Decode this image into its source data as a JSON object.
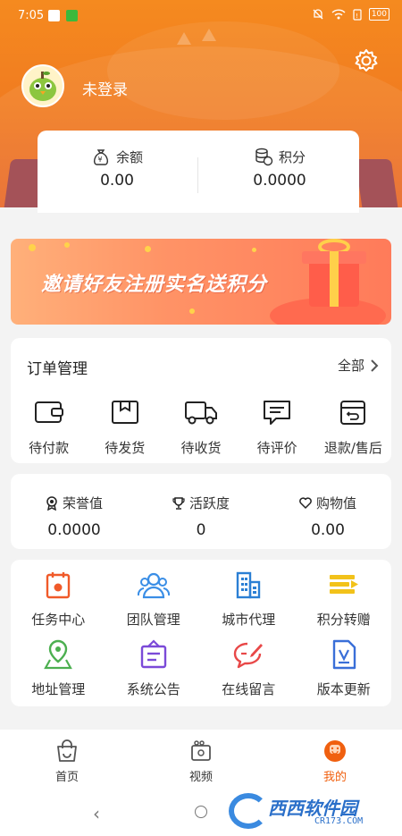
{
  "status_bar": {
    "time": "7:05",
    "battery": "100"
  },
  "user": {
    "name": "未登录"
  },
  "balance": {
    "balance_label": "余额",
    "balance_value": "0.00",
    "points_label": "积分",
    "points_value": "0.0000"
  },
  "banner": {
    "text": "邀请好友注册实名送积分"
  },
  "orders": {
    "title": "订单管理",
    "all_label": "全部",
    "items": [
      {
        "label": "待付款",
        "icon": "wallet-icon"
      },
      {
        "label": "待发货",
        "icon": "box-icon"
      },
      {
        "label": "待收货",
        "icon": "truck-icon"
      },
      {
        "label": "待评价",
        "icon": "comment-icon"
      },
      {
        "label": "退款/售后",
        "icon": "refund-icon"
      }
    ]
  },
  "stats": [
    {
      "label": "荣誉值",
      "value": "0.0000",
      "icon": "medal-icon"
    },
    {
      "label": "活跃度",
      "value": "0",
      "icon": "trophy-icon"
    },
    {
      "label": "购物值",
      "value": "0.00",
      "icon": "heart-icon"
    }
  ],
  "services": [
    {
      "label": "任务中心",
      "icon": "calendar-icon",
      "color": "#f05a2a"
    },
    {
      "label": "团队管理",
      "icon": "team-icon",
      "color": "#3a8ee6"
    },
    {
      "label": "城市代理",
      "icon": "building-icon",
      "color": "#2b7fd4"
    },
    {
      "label": "积分转赠",
      "icon": "transfer-icon",
      "color": "#f2c21a"
    },
    {
      "label": "地址管理",
      "icon": "location-icon",
      "color": "#4caf50"
    },
    {
      "label": "系统公告",
      "icon": "notice-icon",
      "color": "#7b4ad8"
    },
    {
      "label": "在线留言",
      "icon": "message-icon",
      "color": "#e84848"
    },
    {
      "label": "版本更新",
      "icon": "document-icon",
      "color": "#3a6fd8"
    }
  ],
  "tabs": [
    {
      "label": "首页",
      "icon": "bag-icon"
    },
    {
      "label": "视频",
      "icon": "video-icon"
    },
    {
      "label": "我的",
      "icon": "smile-icon"
    }
  ],
  "watermark": {
    "text": "西西软件园",
    "url": "CR173.COM"
  },
  "colors": {
    "accent": "#f07a20",
    "active_tab": "#f0600f"
  }
}
